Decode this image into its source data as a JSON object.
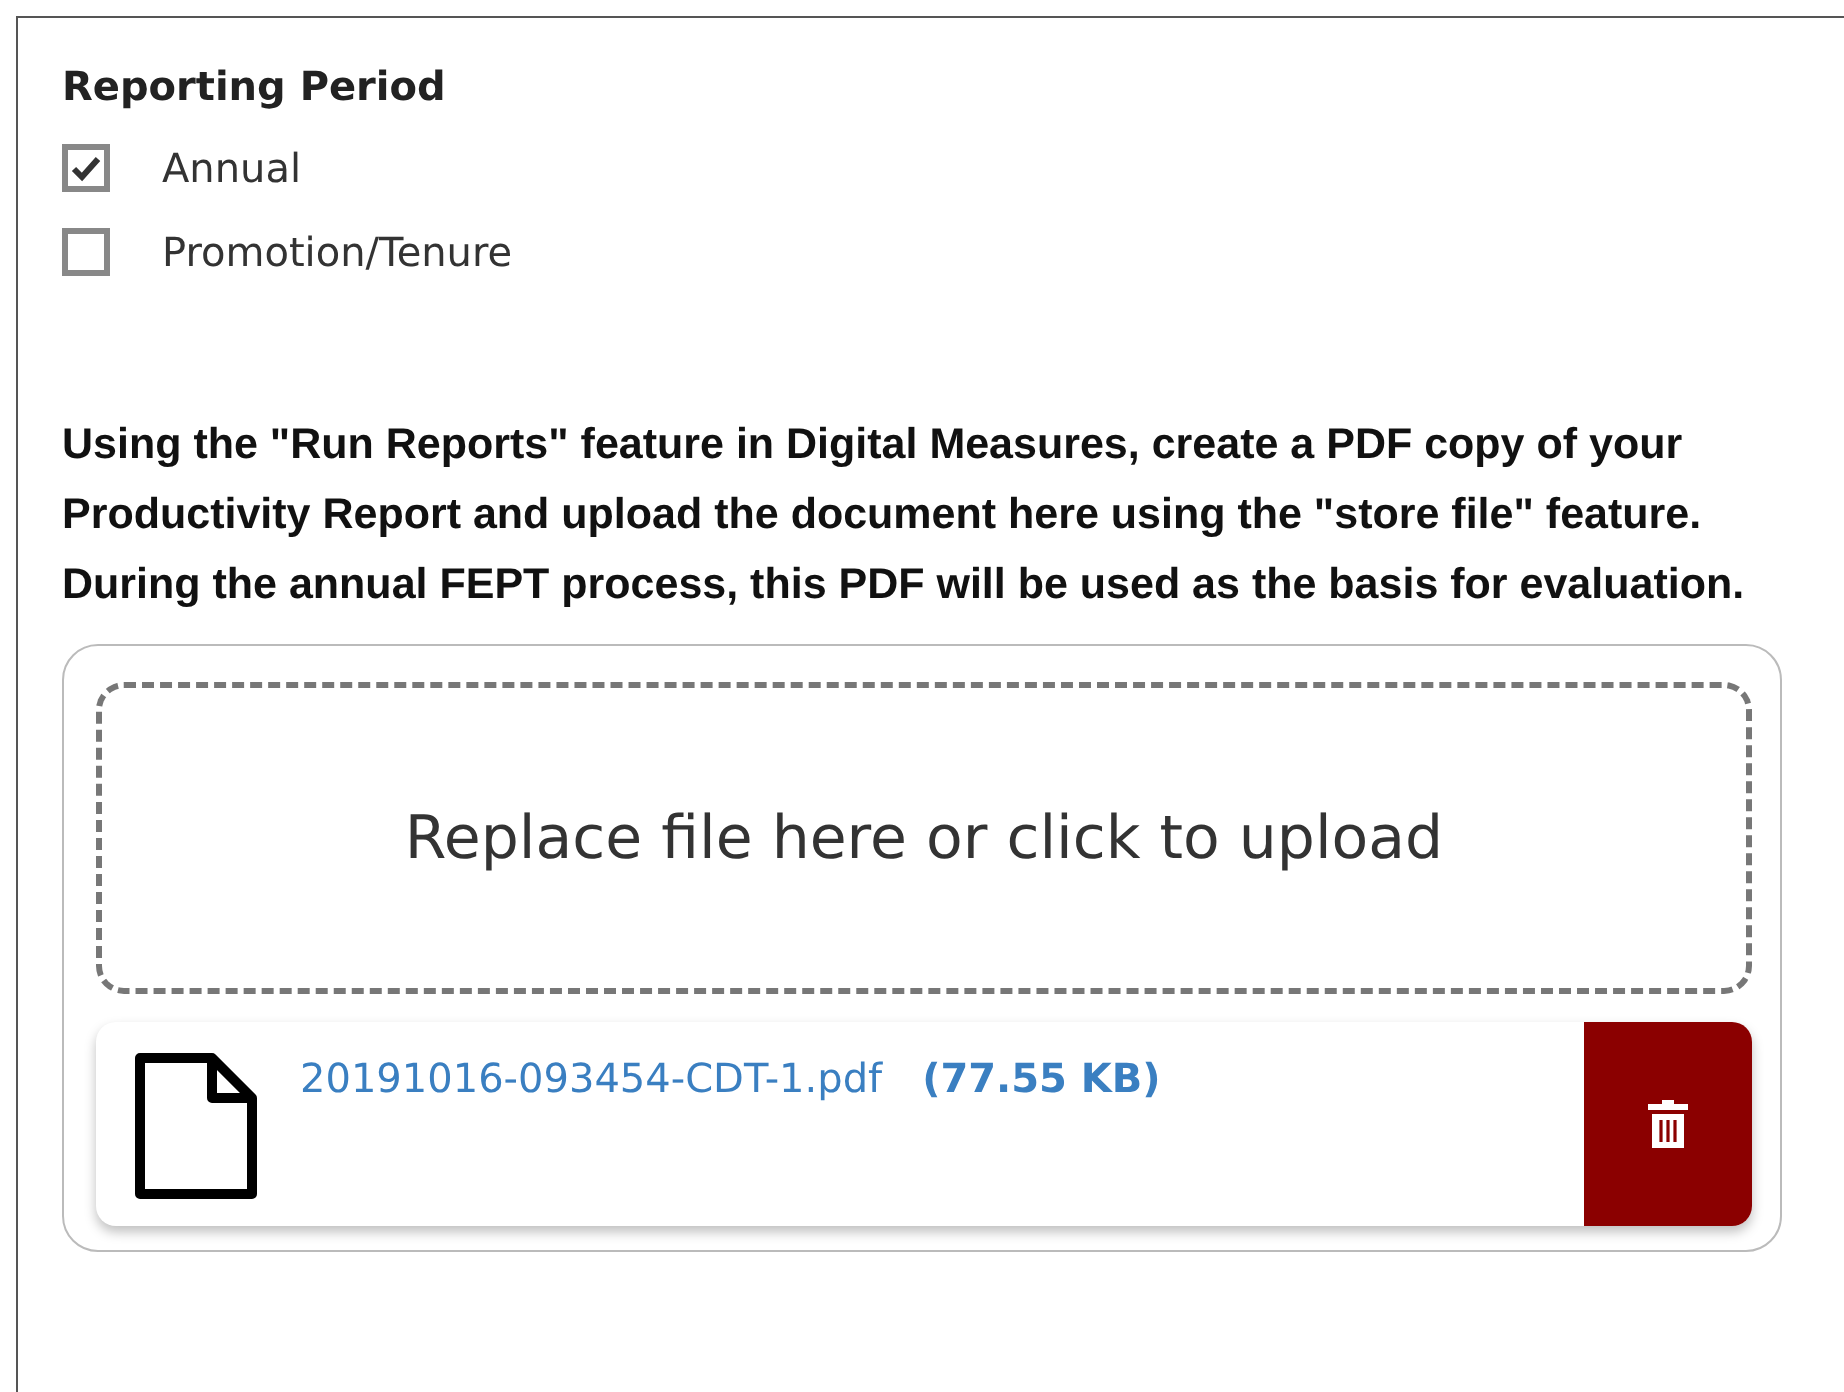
{
  "reporting_period": {
    "title": "Reporting Period",
    "options": [
      {
        "label": "Annual",
        "checked": true
      },
      {
        "label": "Promotion/Tenure",
        "checked": false
      }
    ]
  },
  "instructions": "Using the \"Run Reports\" feature in Digital Measures, create a PDF copy of your Productivity Report and upload the document here using the \"store file\" feature. During the annual FEPT process, this PDF will be used as the basis for evaluation.",
  "upload": {
    "dropzone_text": "Replace file here or click to upload",
    "file": {
      "name": "20191016-093454-CDT-1.pdf",
      "size": "(77.55 KB)"
    }
  }
}
